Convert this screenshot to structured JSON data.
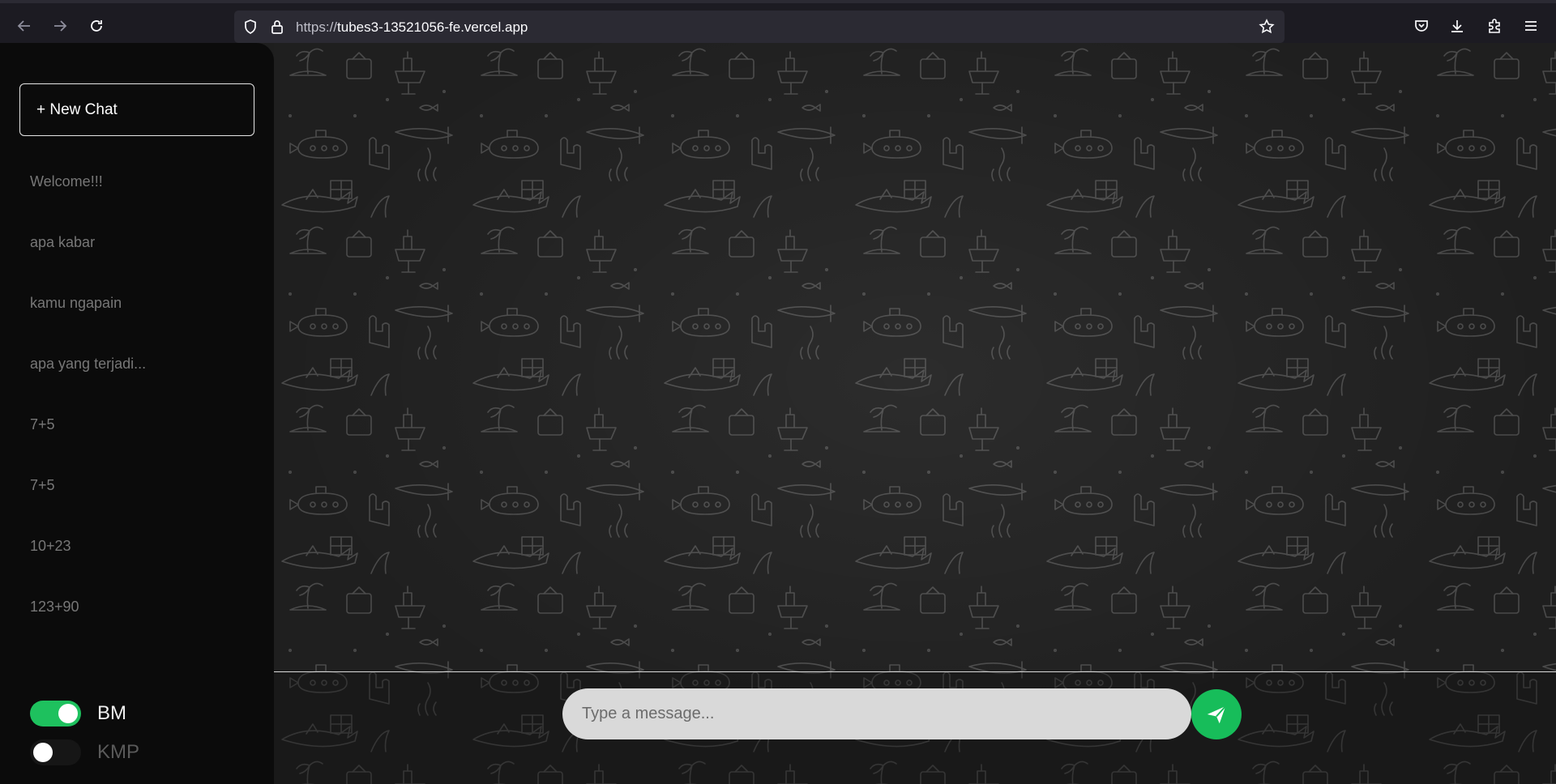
{
  "browser": {
    "url_scheme": "https://",
    "url_host": "tubes3-13521056-fe.vercel.app"
  },
  "sidebar": {
    "new_chat_label": "+ New Chat",
    "history": [
      "Welcome!!!",
      "apa kabar",
      "kamu ngapain",
      "apa yang terjadi...",
      "7+5",
      "7+5",
      "10+23",
      "123+90"
    ],
    "toggles": [
      {
        "label": "BM",
        "on": true
      },
      {
        "label": "KMP",
        "on": false
      }
    ]
  },
  "composer": {
    "placeholder": "Type a message..."
  },
  "colors": {
    "accent": "#1ec15e",
    "sidebar_bg": "#0b0b0b",
    "chat_bg": "#1f1f1f"
  }
}
